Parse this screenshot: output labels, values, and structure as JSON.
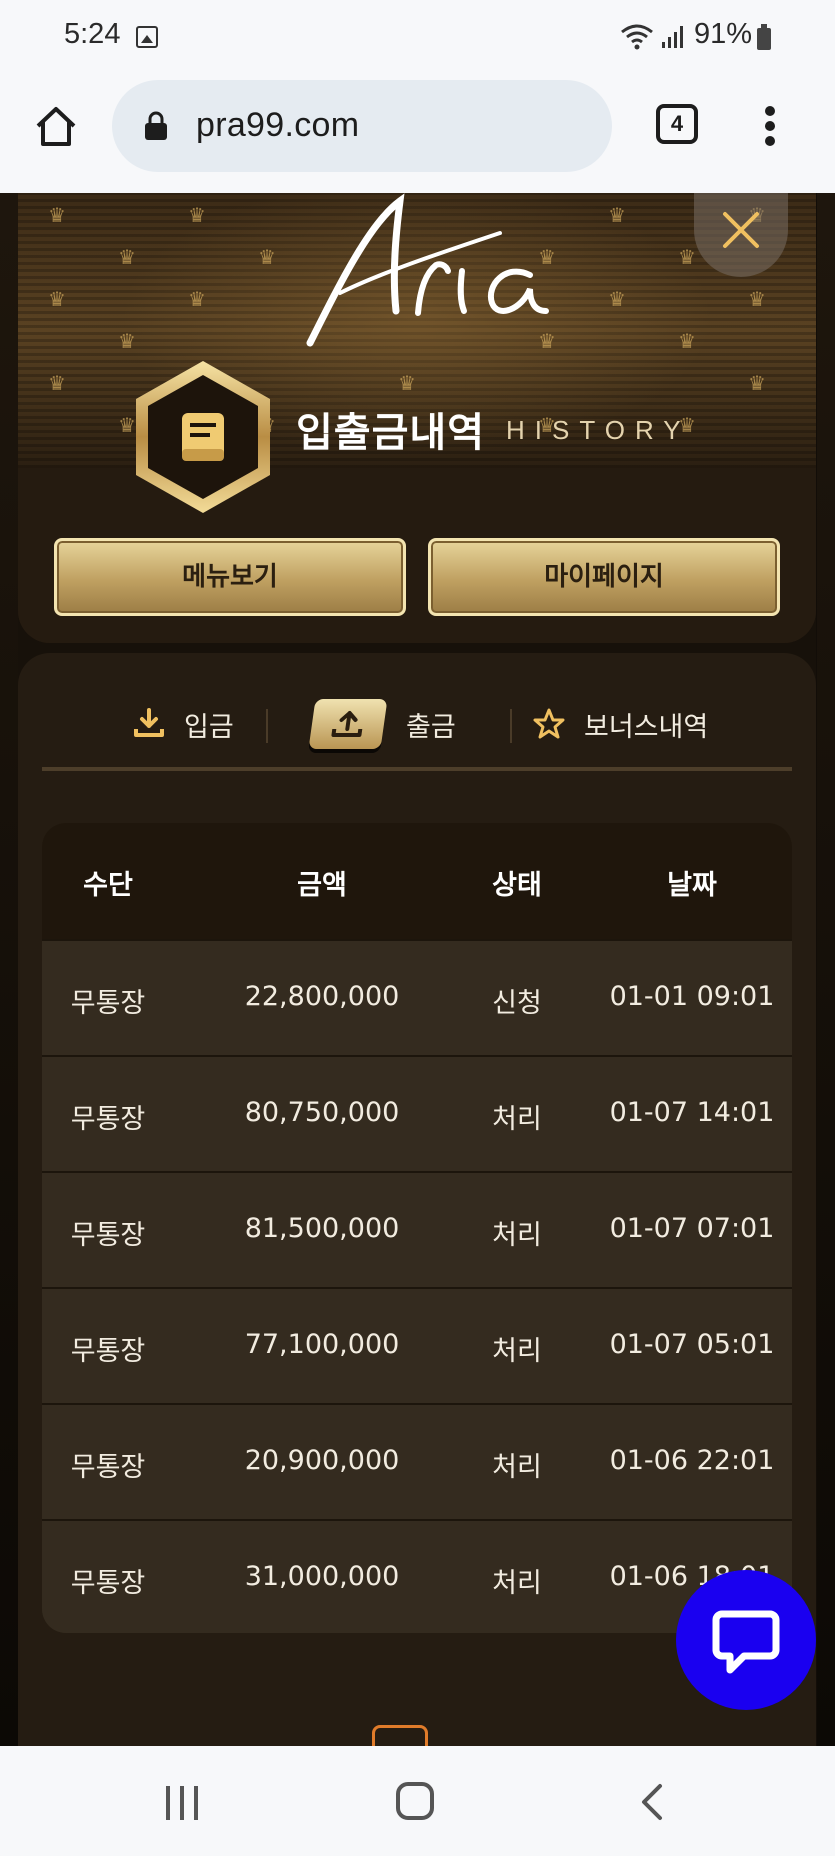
{
  "status_bar": {
    "time": "5:24",
    "battery": "91%"
  },
  "browser": {
    "url": "pra99.com",
    "tab_count": "4"
  },
  "header": {
    "logo_text": "Aria",
    "title": "입출금내역",
    "subtitle": "HISTORY",
    "buttons": {
      "menu": "메뉴보기",
      "mypage": "마이페이지"
    }
  },
  "tabs": [
    {
      "label": "입금",
      "icon": "download-icon",
      "active": false
    },
    {
      "label": "출금",
      "icon": "upload-icon",
      "active": true
    },
    {
      "label": "보너스내역",
      "icon": "star-icon",
      "active": false
    }
  ],
  "table": {
    "columns": [
      "수단",
      "금액",
      "상태",
      "날짜"
    ],
    "rows": [
      [
        "무통장",
        "22,800,000",
        "신청",
        "01-01 09:01"
      ],
      [
        "무통장",
        "80,750,000",
        "처리",
        "01-07 14:01"
      ],
      [
        "무통장",
        "81,500,000",
        "처리",
        "01-07 07:01"
      ],
      [
        "무통장",
        "77,100,000",
        "처리",
        "01-07 05:01"
      ],
      [
        "무통장",
        "20,900,000",
        "처리",
        "01-06 22:01"
      ],
      [
        "무통장",
        "31,000,000",
        "처리",
        "01-06 18:01"
      ]
    ]
  },
  "colors": {
    "gold": "#c9a35a",
    "panel": "#251c12",
    "chat_button": "#1a00f0"
  }
}
